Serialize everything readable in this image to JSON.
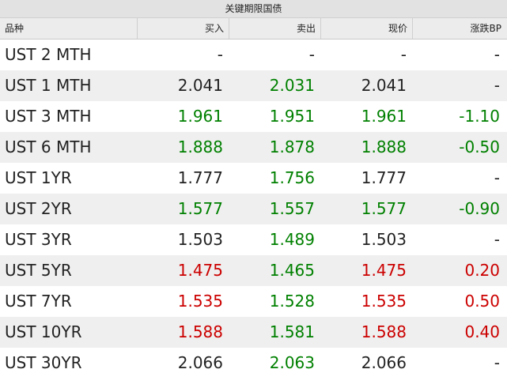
{
  "title": "关键期限国债",
  "columns": [
    "品种",
    "买入",
    "卖出",
    "现价",
    "涨跌BP"
  ],
  "colors": {
    "up": "#cc0000",
    "down": "#008000",
    "neutral": "#222222"
  },
  "rows": [
    {
      "name": "UST 2 MTH",
      "bid": "-",
      "bid_c": "neutral",
      "ask": "-",
      "ask_c": "neutral",
      "last": "-",
      "last_c": "neutral",
      "chg": "-",
      "chg_c": "neutral"
    },
    {
      "name": "UST 1 MTH",
      "bid": "2.041",
      "bid_c": "neutral",
      "ask": "2.031",
      "ask_c": "down",
      "last": "2.041",
      "last_c": "neutral",
      "chg": "-",
      "chg_c": "neutral"
    },
    {
      "name": "UST 3 MTH",
      "bid": "1.961",
      "bid_c": "down",
      "ask": "1.951",
      "ask_c": "down",
      "last": "1.961",
      "last_c": "down",
      "chg": "-1.10",
      "chg_c": "down"
    },
    {
      "name": "UST 6 MTH",
      "bid": "1.888",
      "bid_c": "down",
      "ask": "1.878",
      "ask_c": "down",
      "last": "1.888",
      "last_c": "down",
      "chg": "-0.50",
      "chg_c": "down"
    },
    {
      "name": "UST 1YR",
      "bid": "1.777",
      "bid_c": "neutral",
      "ask": "1.756",
      "ask_c": "down",
      "last": "1.777",
      "last_c": "neutral",
      "chg": "-",
      "chg_c": "neutral"
    },
    {
      "name": "UST 2YR",
      "bid": "1.577",
      "bid_c": "down",
      "ask": "1.557",
      "ask_c": "down",
      "last": "1.577",
      "last_c": "down",
      "chg": "-0.90",
      "chg_c": "down"
    },
    {
      "name": "UST 3YR",
      "bid": "1.503",
      "bid_c": "neutral",
      "ask": "1.489",
      "ask_c": "down",
      "last": "1.503",
      "last_c": "neutral",
      "chg": "-",
      "chg_c": "neutral"
    },
    {
      "name": "UST 5YR",
      "bid": "1.475",
      "bid_c": "up",
      "ask": "1.465",
      "ask_c": "down",
      "last": "1.475",
      "last_c": "up",
      "chg": "0.20",
      "chg_c": "up"
    },
    {
      "name": "UST 7YR",
      "bid": "1.535",
      "bid_c": "up",
      "ask": "1.528",
      "ask_c": "down",
      "last": "1.535",
      "last_c": "up",
      "chg": "0.50",
      "chg_c": "up"
    },
    {
      "name": "UST 10YR",
      "bid": "1.588",
      "bid_c": "up",
      "ask": "1.581",
      "ask_c": "down",
      "last": "1.588",
      "last_c": "up",
      "chg": "0.40",
      "chg_c": "up"
    },
    {
      "name": "UST 30YR",
      "bid": "2.066",
      "bid_c": "neutral",
      "ask": "2.063",
      "ask_c": "down",
      "last": "2.066",
      "last_c": "neutral",
      "chg": "-",
      "chg_c": "neutral"
    }
  ]
}
